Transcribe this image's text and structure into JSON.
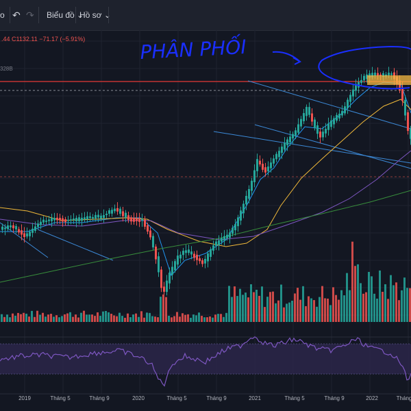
{
  "toolbar": {
    "fragment": "o",
    "undo_icon": "undo-icon",
    "redo_icon": "redo-icon",
    "chart_label": "Biểu đồ",
    "profile_label": "Hồ sơ"
  },
  "legend": {
    "ohlc_fragment": ".44  C1132.11  −71.17 (−5.91%)",
    "volume_fragment": "328B"
  },
  "annotation": {
    "text": "PHÂN PHỐI",
    "color": "#1a2fff"
  },
  "colors": {
    "up": "#26a69a",
    "down": "#ef5350",
    "ma_fast": "#2196f3",
    "ma_mid": "#f0b93a",
    "ma_slow": "#7e57c2",
    "ma_long": "#388e3c",
    "rsi": "#7e57c2",
    "highlight": "#f5b942",
    "trendline": "#3c8ad8"
  },
  "chart_data": {
    "type": "candlestick",
    "x_axis_labels": [
      "2019",
      "Tháng 5",
      "Tháng 9",
      "2020",
      "Tháng 5",
      "Tháng 9",
      "2021",
      "Tháng 5",
      "Tháng 9",
      "2022",
      "Tháng"
    ],
    "price_axis": "not visible",
    "moving_averages": [
      "fast",
      "mid",
      "slow",
      "long"
    ],
    "panels": [
      "price",
      "volume",
      "rsi"
    ],
    "rsi_band": [
      30,
      70
    ],
    "horizontal_lines": [
      "red solid resistance line",
      "dashed line at top",
      "dashed line at mid"
    ]
  }
}
